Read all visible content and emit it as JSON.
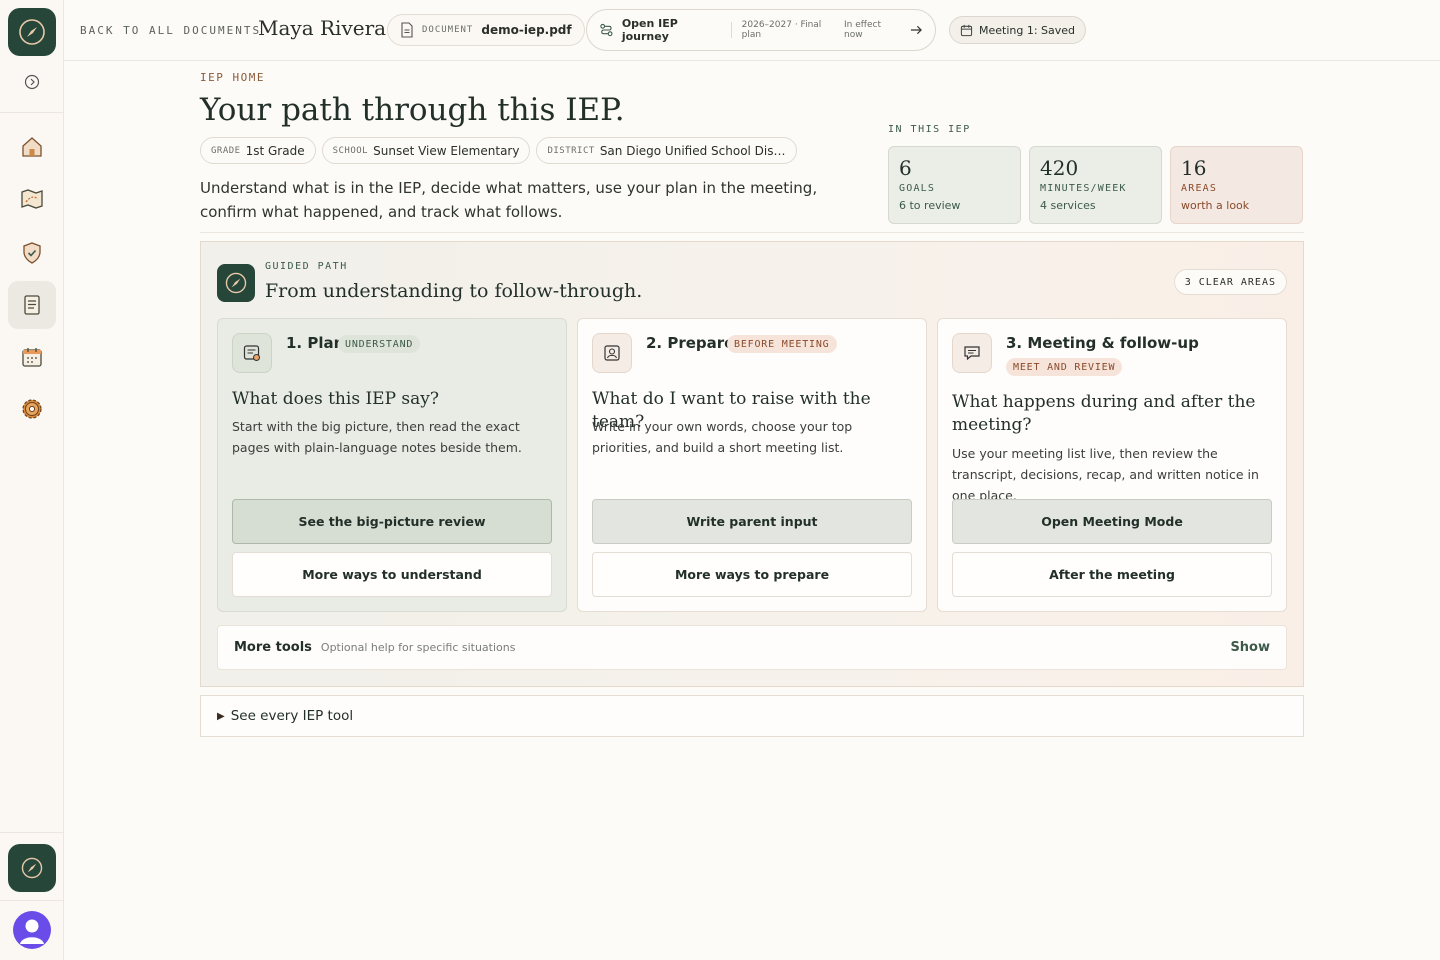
{
  "topbar": {
    "back_label": "BACK TO ALL DOCUMENTS",
    "student_name": "Maya Rivera",
    "document_key": "DOCUMENT",
    "document_value": "demo-iep.pdf",
    "journey_label": "Open IEP journey",
    "journey_year": "2026–2027 · Final plan",
    "journey_status": "In effect now",
    "meeting_label": "Meeting 1: Saved"
  },
  "header": {
    "eyebrow": "IEP HOME",
    "title": "Your path through this IEP.",
    "chips": [
      {
        "key": "GRADE",
        "value": "1st Grade"
      },
      {
        "key": "SCHOOL",
        "value": "Sunset View Elementary"
      },
      {
        "key": "DISTRICT",
        "value": "San Diego Unified School Dis…"
      }
    ],
    "intro": "Understand what is in the IEP, decide what matters, use your plan in the meeting, confirm what happened, and track what follows."
  },
  "stats": {
    "label": "IN THIS IEP",
    "items": [
      {
        "num": "6",
        "label": "GOALS",
        "sub": "6 to review"
      },
      {
        "num": "420",
        "label": "MINUTES/WEEK",
        "sub": "4 services"
      },
      {
        "num": "16",
        "label": "AREAS",
        "sub": "worth a look"
      }
    ]
  },
  "guided": {
    "eyebrow": "GUIDED PATH",
    "title": "From understanding to follow-through.",
    "badge": "3 CLEAR AREAS",
    "cards": [
      {
        "step": "1. Plan",
        "tag": "UNDERSTAND",
        "question": "What does this IEP say?",
        "desc": "Start with the big picture, then read the exact pages with plain-language notes beside them.",
        "primary": "See the big-picture review",
        "secondary": "More ways to understand"
      },
      {
        "step": "2. Prepare",
        "tag": "BEFORE MEETING",
        "question": "What do I want to raise with the team?",
        "desc": "Write in your own words, choose your top priorities, and build a short meeting list.",
        "primary": "Write parent input",
        "secondary": "More ways to prepare"
      },
      {
        "step": "3. Meeting & follow-up",
        "tag": "MEET AND REVIEW",
        "question": "What happens during and after the meeting?",
        "desc": "Use your meeting list live, then review the transcript, decisions, recap, and written notice in one place.",
        "primary": "Open Meeting Mode",
        "secondary": "After the meeting"
      }
    ],
    "more_tools": {
      "title": "More tools",
      "subtitle": "Optional help for specific situations",
      "action": "Show"
    }
  },
  "every_tool": "See every IEP tool",
  "colors": {
    "brand": "#26463a",
    "accent_warm": "#8a4a2a",
    "accent_green": "#3c5a4a"
  }
}
